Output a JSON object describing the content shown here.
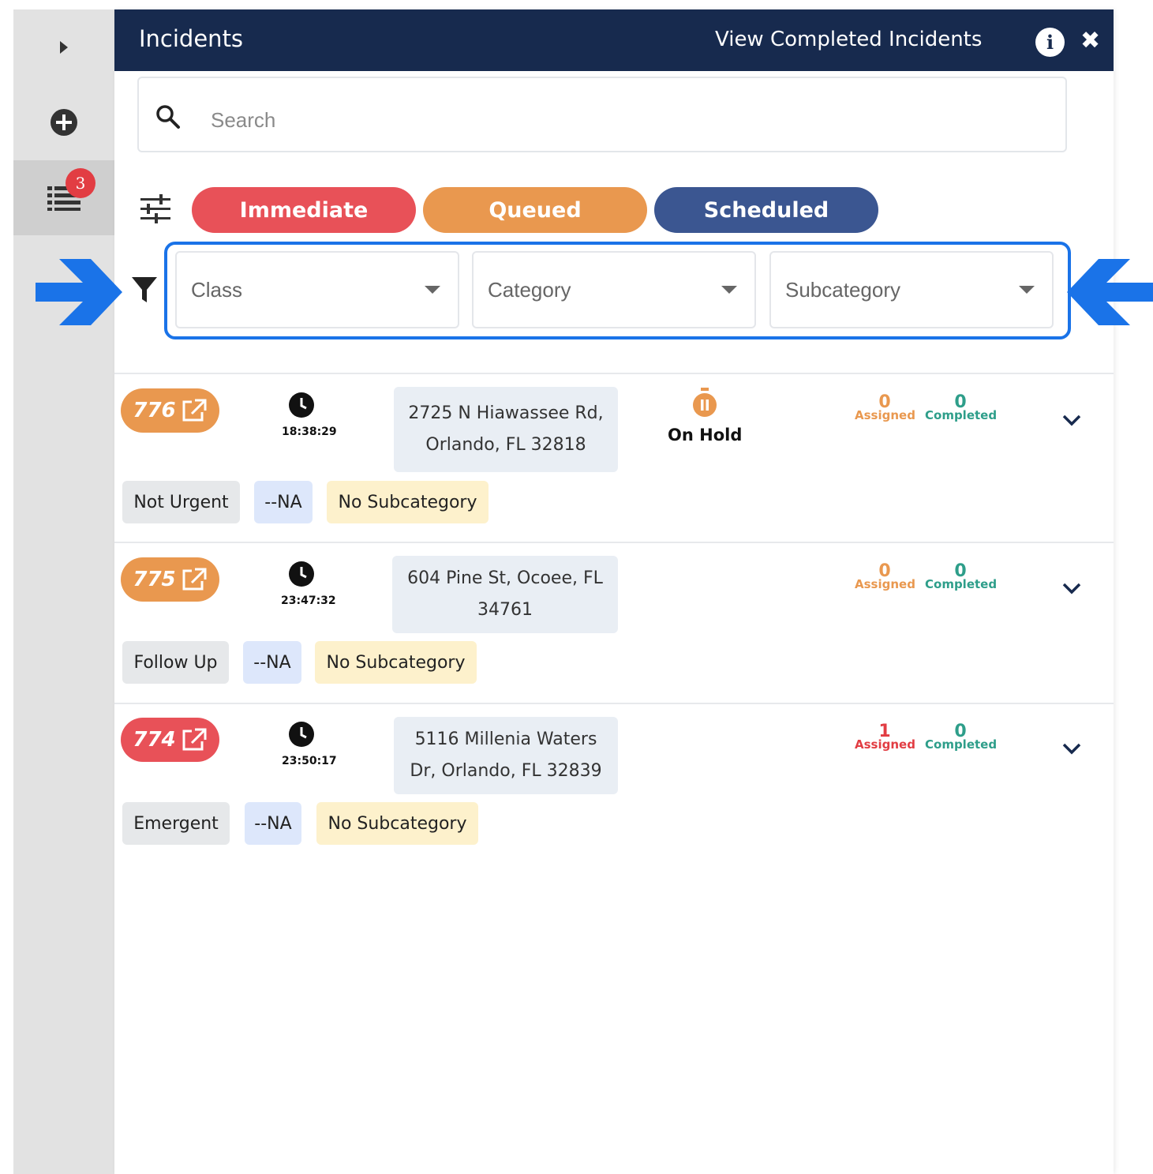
{
  "header": {
    "title": "Incidents",
    "view_completed": "View Completed Incidents"
  },
  "rail": {
    "badge_count": "3"
  },
  "search": {
    "placeholder": "Search"
  },
  "priority_filters": [
    {
      "label": "Immediate",
      "color": "#e85158"
    },
    {
      "label": "Queued",
      "color": "#e9984f"
    },
    {
      "label": "Scheduled",
      "color": "#3b5691"
    }
  ],
  "filters": {
    "class": "Class",
    "category": "Category",
    "subcategory": "Subcategory"
  },
  "counter_labels": {
    "assigned": "Assigned",
    "completed": "Completed"
  },
  "incidents": [
    {
      "id": "776",
      "badge_color": "#e9984f",
      "time": "18:38:29",
      "address": "2725 N Hiawassee Rd, Orlando, FL 32818",
      "status": "On Hold",
      "assigned": "0",
      "completed": "0",
      "assigned_color": "#e9984f",
      "tags": [
        "Not Urgent",
        "--NA",
        "No Subcategory"
      ]
    },
    {
      "id": "775",
      "badge_color": "#e9984f",
      "time": "23:47:32",
      "address": "604 Pine St, Ocoee, FL 34761",
      "status": "",
      "assigned": "0",
      "completed": "0",
      "assigned_color": "#e9984f",
      "tags": [
        "Follow Up",
        "--NA",
        "No Subcategory"
      ]
    },
    {
      "id": "774",
      "badge_color": "#e85158",
      "time": "23:50:17",
      "address": "5116 Millenia Waters Dr, Orlando, FL 32839",
      "status": "",
      "assigned": "1",
      "completed": "0",
      "assigned_color": "#e23d43",
      "tags": [
        "Emergent",
        "--NA",
        "No Subcategory"
      ]
    }
  ],
  "colors": {
    "header_bg": "#172a4e",
    "completed_green": "#2e9e8a",
    "highlight_blue": "#1a73e8"
  }
}
